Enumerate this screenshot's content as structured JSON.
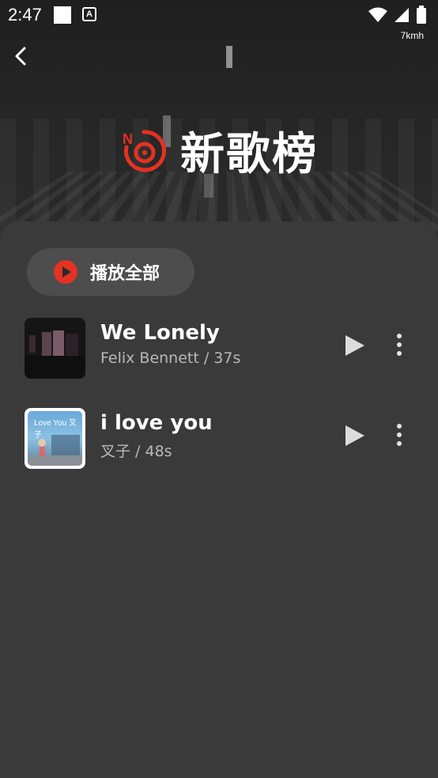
{
  "status_bar": {
    "time": "2:47",
    "a_glyph": "A",
    "speed": "7kmh",
    "icons": [
      "notification-square-icon",
      "a-notification-icon",
      "wifi-icon",
      "signal-icon",
      "battery-icon"
    ]
  },
  "header": {
    "title": "新歌榜",
    "logo_letter": "N",
    "back_icon": "chevron-left-icon"
  },
  "colors": {
    "accent": "#e33222",
    "panel": "#3a3a3a",
    "play_all_bg": "#4d4d4d",
    "subtitle": "#b9b9b9"
  },
  "play_all": {
    "label": "播放全部"
  },
  "songs": [
    {
      "title": "We Lonely",
      "subtitle": "Felix Bennett / 37s"
    },
    {
      "title": "i love you",
      "subtitle": "叉子 / 48s",
      "cover_text": "Love You 叉子"
    }
  ]
}
